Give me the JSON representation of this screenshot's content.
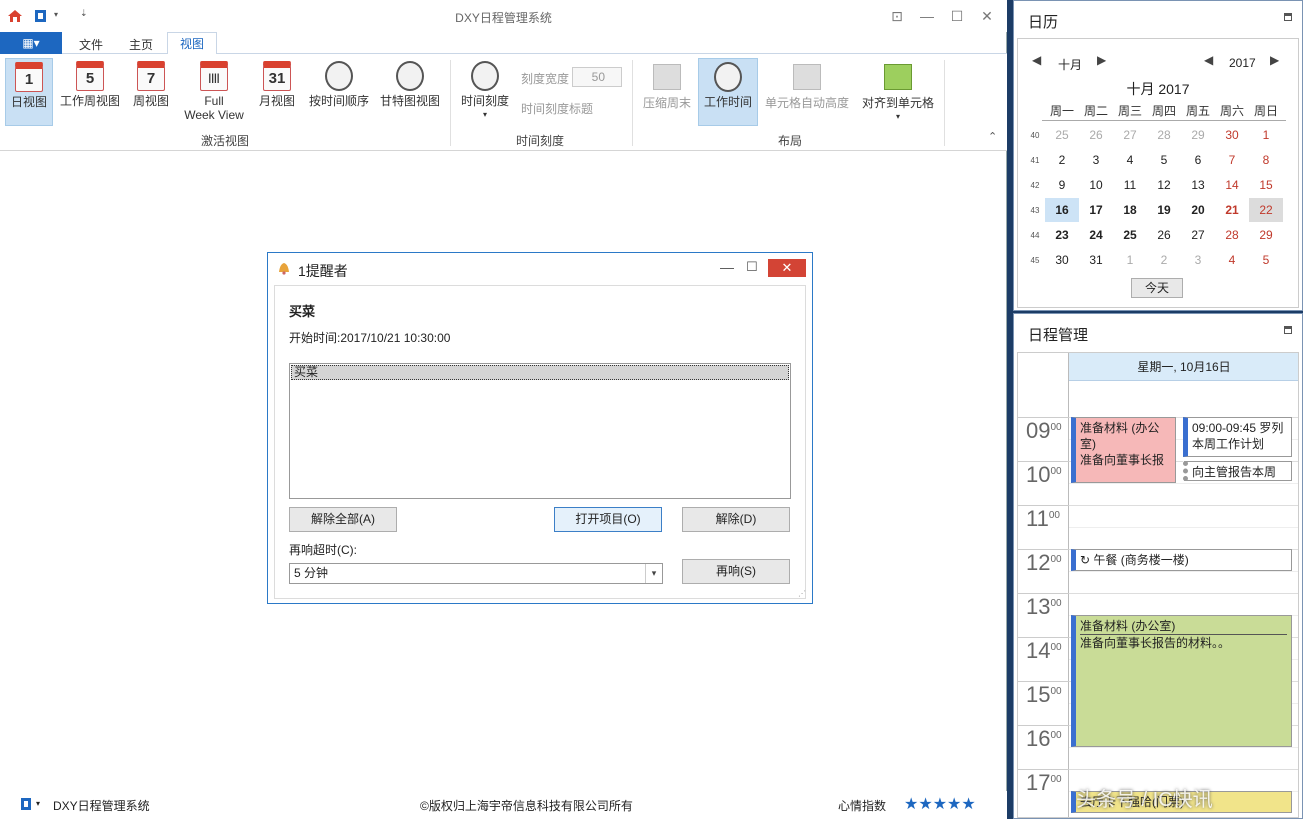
{
  "window": {
    "title": "DXY日程管理系统"
  },
  "menu": {
    "file_btn": "▦▾",
    "file": "文件",
    "home": "主页",
    "view": "视图"
  },
  "ribbon": {
    "day_view": "日视图",
    "day_num": "1",
    "workweek_view": "工作周视图",
    "workweek_num": "5",
    "week_view": "周视图",
    "week_num": "7",
    "full_week_1": "Full",
    "full_week_2": "Week View",
    "month_view": "月视图",
    "month_num": "31",
    "time_order": "按时间顺序",
    "gantt": "甘特图视图",
    "group_activate": "激活视图",
    "timescale": "时间刻度",
    "scale_width_label": "刻度宽度",
    "scale_width_value": "50",
    "timescale_caption": "时间刻度标题",
    "group_timescale": "时间刻度",
    "compress_weekend": "压缩周末",
    "work_time": "工作时间",
    "auto_height": "单元格自动高度",
    "snap": "对齐到单元格",
    "group_layout": "布局"
  },
  "dialog": {
    "title": "1提醒者",
    "subject": "买菜",
    "start": "开始时间:2017/10/21 10:30:00",
    "list_items": [
      "买菜"
    ],
    "dismiss_all": "解除全部(A)",
    "open_item": "打开项目(O)",
    "dismiss": "解除(D)",
    "snooze_label": "再响超时(C):",
    "snooze_value": "5 分钟",
    "snooze": "再响(S)"
  },
  "status": {
    "app": "DXY日程管理系统",
    "copyright": "©版权归上海宇帝信息科技有限公司所有",
    "mood": "心情指数",
    "stars": "★★★★★"
  },
  "calendar": {
    "title": "日历",
    "month_nav": "十月",
    "year_nav": "2017",
    "heading": "十月 2017",
    "weekdays": [
      "周一",
      "周二",
      "周三",
      "周四",
      "周五",
      "周六",
      "周日"
    ],
    "weeks": [
      "40",
      "41",
      "42",
      "43",
      "44",
      "45"
    ],
    "days": [
      [
        "25",
        "26",
        "27",
        "28",
        "29",
        "30",
        "1"
      ],
      [
        "2",
        "3",
        "4",
        "5",
        "6",
        "7",
        "8"
      ],
      [
        "9",
        "10",
        "11",
        "12",
        "13",
        "14",
        "15"
      ],
      [
        "16",
        "17",
        "18",
        "19",
        "20",
        "21",
        "22"
      ],
      [
        "23",
        "24",
        "25",
        "26",
        "27",
        "28",
        "29"
      ],
      [
        "30",
        "31",
        "1",
        "2",
        "3",
        "4",
        "5"
      ]
    ],
    "today_btn": "今天"
  },
  "schedule": {
    "title": "日程管理",
    "date_header": "星期一, 10月16日",
    "hours": [
      "09",
      "10",
      "11",
      "12",
      "13",
      "14",
      "15",
      "16",
      "17"
    ],
    "minutes": "00",
    "appt1_line1": "准备材料 (办公室)",
    "appt1_line2": "准备向董事长报",
    "appt2": "09:00-09:45 罗列本周工作计划",
    "appt3": "向主管报告本周",
    "appt4": "午餐 (商务楼一楼)",
    "appt5_title": "准备材料 (办公室)",
    "appt5_body": "准备向董事长报告的材料。。",
    "appt6": "去厅卡下强哈(门票)",
    "watermark": "头条号 / IC快讯"
  }
}
